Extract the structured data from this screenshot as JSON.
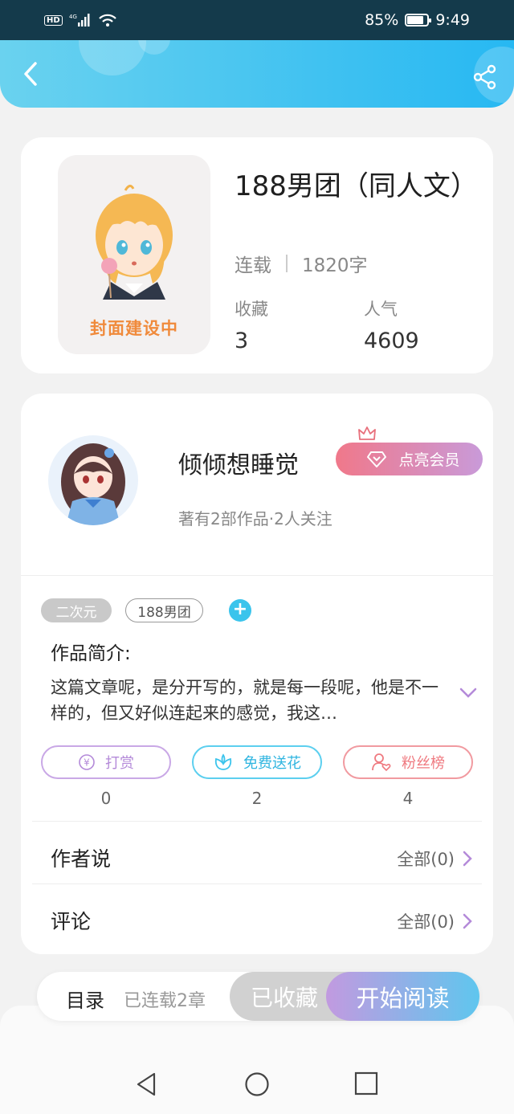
{
  "status_bar": {
    "network": "4G",
    "hd": "HD",
    "battery": "85%",
    "battery_level": 0.85,
    "time": "9:49"
  },
  "colors": {
    "header_gradient": [
      "#6ad2ef",
      "#27b8f2"
    ],
    "cover_text": "#f08a3b",
    "reward": "#b48ad9",
    "flower": "#3bc4ec",
    "fans": "#ef7a80",
    "read_gradient": [
      "#c29ae0",
      "#5fc6ee"
    ]
  },
  "header": {
    "back_icon": "chevron-left-icon",
    "share_icon": "share-icon"
  },
  "book": {
    "cover_text": "封面建设中",
    "title": "188男团（同人文）",
    "status": "连载",
    "word_count": "1820字",
    "collect_label": "收藏",
    "collect_value": "3",
    "popularity_label": "人气",
    "popularity_value": "4609"
  },
  "author": {
    "name": "倾倾想睡觉",
    "info": "著有2部作品·2人关注",
    "vip_label": "点亮会员"
  },
  "tags": [
    "二次元",
    "188男团"
  ],
  "intro": {
    "title": "作品简介:",
    "text": "这篇文章呢，是分开写的，就是每一段呢，他是不一样的，但又好似连起来的感觉，我这…"
  },
  "actions": [
    {
      "label": "打赏",
      "count": "0",
      "icon": "yen-coin-icon"
    },
    {
      "label": "免费送花",
      "count": "2",
      "icon": "flower-icon"
    },
    {
      "label": "粉丝榜",
      "count": "4",
      "icon": "user-heart-icon"
    }
  ],
  "rows": {
    "author_says": {
      "label": "作者说",
      "link": "全部(0)"
    },
    "comments": {
      "label": "评论",
      "link": "全部(0)"
    }
  },
  "bottom": {
    "toc_label": "目录",
    "toc_sub": "已连载2章",
    "collected_label": "已收藏",
    "read_label": "开始阅读"
  }
}
